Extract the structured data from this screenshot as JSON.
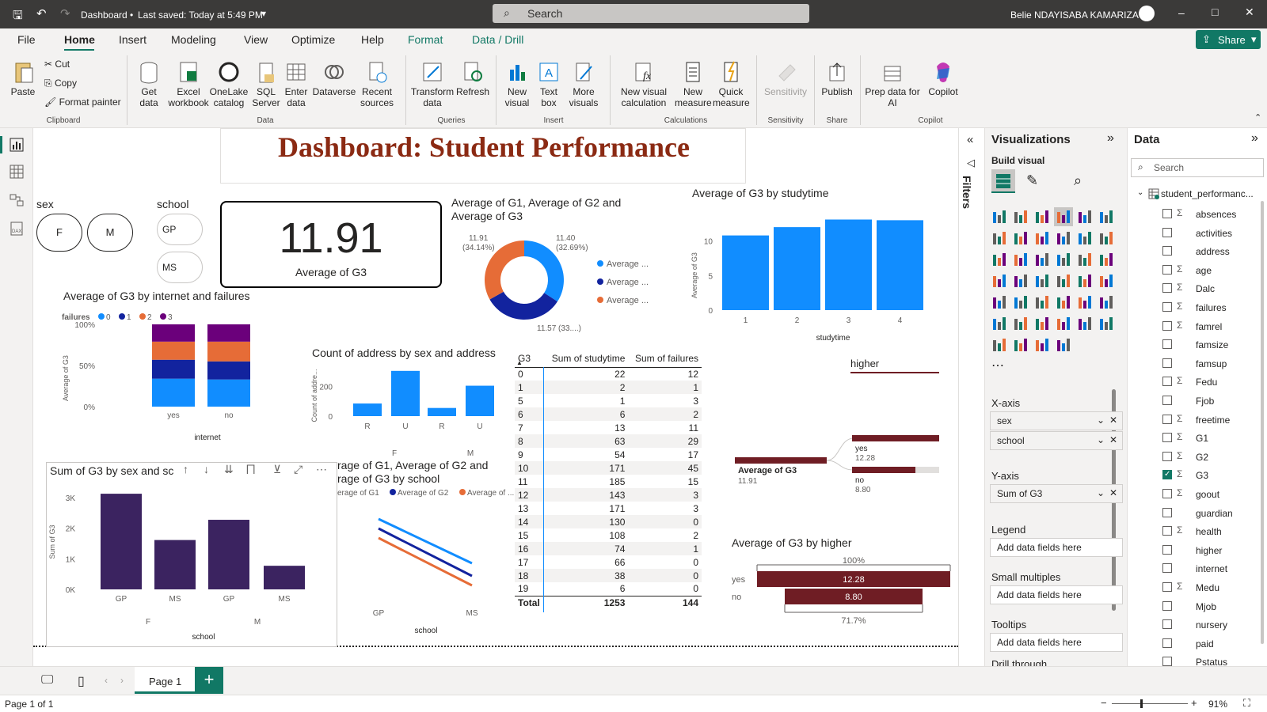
{
  "titlebar": {
    "doc": "Dashboard",
    "saved": "Last saved: Today at 5:49 PM",
    "search": "Search",
    "user": "Belie NDAYISABA KAMARIZA"
  },
  "menu": [
    "File",
    "Home",
    "Insert",
    "Modeling",
    "View",
    "Optimize",
    "Help",
    "Format",
    "Data / Drill"
  ],
  "share": "Share",
  "ribbon": {
    "paste": "Paste",
    "cut": "Cut",
    "copy": "Copy",
    "format_painter": "Format painter",
    "clipboard": "Clipboard",
    "get_data": "Get data",
    "excel": "Excel workbook",
    "onelake": "OneLake catalog",
    "sql": "SQL Server",
    "enter": "Enter data",
    "dataverse": "Dataverse",
    "recent": "Recent sources",
    "data": "Data",
    "transform": "Transform data",
    "refresh": "Refresh",
    "queries": "Queries",
    "new_visual": "New visual",
    "text_box": "Text box",
    "more_visuals": "More visuals",
    "insert": "Insert",
    "new_visual_calc": "New visual calculation",
    "new_measure": "New measure",
    "quick_measure": "Quick measure",
    "calculations": "Calculations",
    "sensitivity": "Sensitivity",
    "sensitivity_grp": "Sensitivity",
    "publish": "Publish",
    "share_grp": "Share",
    "prep": "Prep data for AI",
    "copilot": "Copilot",
    "copilot_grp": "Copilot"
  },
  "dashboard": {
    "title": "Dashboard: Student Performance",
    "sex_slicer": {
      "title": "sex",
      "items": [
        "F",
        "M"
      ]
    },
    "school_slicer": {
      "title": "school",
      "items": [
        "GP",
        "MS"
      ]
    },
    "card": {
      "value": "11.91",
      "label": "Average of G3"
    },
    "donut": {
      "title": "Average of G1, Average of G2 and Average of G3",
      "legend": [
        "Average ...",
        "Average ...",
        "Average ..."
      ],
      "lbl1": "11.91",
      "lbl1b": "(34.14%)",
      "lbl2": "11.40",
      "lbl2b": "(32.69%)",
      "lbl3": "11.57 (33....)"
    },
    "studytime_chart": {
      "title": "Average of G3 by studytime",
      "xlabel": "studytime",
      "ylabel": "Average of G3"
    },
    "internet_chart": {
      "title": "Average of G3 by internet and failures",
      "legend_title": "failures",
      "legend": [
        "0",
        "1",
        "2",
        "3"
      ],
      "ylabel": "Average of G3",
      "xlabel": "internet"
    },
    "address_chart": {
      "title": "Count of address by sex and address",
      "ylabel": "Count of addre...",
      "groups": [
        "F",
        "M"
      ]
    },
    "matrix": {
      "headers": [
        "G3",
        "Sum of studytime",
        "Sum of failures"
      ],
      "rows": [
        [
          "0",
          "22",
          "12"
        ],
        [
          "1",
          "2",
          "1"
        ],
        [
          "5",
          "1",
          "3"
        ],
        [
          "6",
          "6",
          "2"
        ],
        [
          "7",
          "13",
          "11"
        ],
        [
          "8",
          "63",
          "29"
        ],
        [
          "9",
          "54",
          "17"
        ],
        [
          "10",
          "171",
          "45"
        ],
        [
          "11",
          "185",
          "15"
        ],
        [
          "12",
          "143",
          "3"
        ],
        [
          "13",
          "171",
          "3"
        ],
        [
          "14",
          "130",
          "0"
        ],
        [
          "15",
          "108",
          "2"
        ],
        [
          "16",
          "74",
          "1"
        ],
        [
          "17",
          "66",
          "0"
        ],
        [
          "18",
          "38",
          "0"
        ],
        [
          "19",
          "6",
          "0"
        ]
      ],
      "total": [
        "Total",
        "1253",
        "144"
      ]
    },
    "higher_slicer": {
      "title": "higher"
    },
    "decomp": {
      "root_label": "Average of G3",
      "root_value": "11.91",
      "yes_label": "yes",
      "yes_value": "12.28",
      "no_label": "no",
      "no_value": "8.80"
    },
    "funnel": {
      "title": "Average of G3 by higher",
      "top_pct": "100%",
      "bottom_pct": "71.7%"
    },
    "sum_chart": {
      "title": "Sum of G3 by sex and sc",
      "ylabel": "Sum of G3",
      "xlabel": "school",
      "groups": [
        "F",
        "M"
      ]
    },
    "line_chart": {
      "title_a": "rage of G1, Average of G2 and",
      "title_b": "rage of G3 by school",
      "legend": [
        "erage of G1",
        "Average of G2",
        "Average of ..."
      ],
      "xlabel": "school"
    }
  },
  "viz": {
    "title": "Visualizations",
    "build": "Build visual",
    "xaxis": "X-axis",
    "x1": "sex",
    "x2": "school",
    "yaxis": "Y-axis",
    "y1": "Sum of G3",
    "legend": "Legend",
    "small": "Small multiples",
    "tooltips": "Tooltips",
    "drill": "Drill through",
    "add": "Add data fields here"
  },
  "datapane": {
    "title": "Data",
    "search": "Search",
    "table": "student_performanc...",
    "fields": [
      {
        "n": "absences",
        "s": true
      },
      {
        "n": "activities",
        "s": false
      },
      {
        "n": "address",
        "s": false
      },
      {
        "n": "age",
        "s": true
      },
      {
        "n": "Dalc",
        "s": true
      },
      {
        "n": "failures",
        "s": true
      },
      {
        "n": "famrel",
        "s": true
      },
      {
        "n": "famsize",
        "s": false
      },
      {
        "n": "famsup",
        "s": false
      },
      {
        "n": "Fedu",
        "s": true
      },
      {
        "n": "Fjob",
        "s": false
      },
      {
        "n": "freetime",
        "s": true
      },
      {
        "n": "G1",
        "s": true
      },
      {
        "n": "G2",
        "s": true
      },
      {
        "n": "G3",
        "s": true
      },
      {
        "n": "goout",
        "s": true
      },
      {
        "n": "guardian",
        "s": false
      },
      {
        "n": "health",
        "s": true
      },
      {
        "n": "higher",
        "s": false
      },
      {
        "n": "internet",
        "s": false
      },
      {
        "n": "Medu",
        "s": true
      },
      {
        "n": "Mjob",
        "s": false
      },
      {
        "n": "nursery",
        "s": false
      },
      {
        "n": "paid",
        "s": false
      },
      {
        "n": "Pstatus",
        "s": false
      }
    ]
  },
  "pages": {
    "page1": "Page 1",
    "status": "Page 1 of 1",
    "zoom": "91%"
  },
  "chart_data": [
    {
      "type": "bar",
      "title": "Average of G3 by studytime",
      "categories": [
        "1",
        "2",
        "3",
        "4"
      ],
      "values": [
        10.8,
        12.0,
        13.1,
        13.0
      ],
      "ylim": [
        0,
        13.5
      ],
      "yticks": [
        "0",
        "5",
        "10"
      ],
      "xlabel": "studytime",
      "ylabel": "Average of G3"
    },
    {
      "type": "bar",
      "stacked": "100%",
      "title": "Average of G3 by internet and failures",
      "categories": [
        "yes",
        "no"
      ],
      "series": [
        {
          "name": "0",
          "values": [
            0.34,
            0.33
          ]
        },
        {
          "name": "1",
          "values": [
            0.23,
            0.22
          ]
        },
        {
          "name": "2",
          "values": [
            0.22,
            0.24
          ]
        },
        {
          "name": "3",
          "values": [
            0.21,
            0.21
          ]
        }
      ],
      "yticks": [
        "0%",
        "50%",
        "100%"
      ]
    },
    {
      "type": "bar",
      "title": "Count of address by sex and address",
      "categories": [
        "R",
        "U",
        "R",
        "U"
      ],
      "groups": [
        "F",
        "M"
      ],
      "values": [
        85,
        305,
        55,
        205
      ],
      "ylim": [
        0,
        320
      ],
      "yticks": [
        "0",
        "200"
      ]
    },
    {
      "type": "pie",
      "title": "Average of G1, Average of G2 and Average of G3",
      "values": [
        11.91,
        11.4,
        11.57
      ],
      "percent": [
        34.14,
        32.69,
        33.17
      ]
    },
    {
      "type": "bar",
      "title": "Sum of G3 by sex and school",
      "categories": [
        "GP",
        "MS",
        "GP",
        "MS"
      ],
      "groups": [
        "F",
        "M"
      ],
      "values": [
        3120,
        1610,
        2270,
        770
      ],
      "ylim": [
        0,
        3200
      ],
      "yticks": [
        "0K",
        "1K",
        "2K",
        "3K"
      ]
    },
    {
      "type": "line",
      "title": "Average of G1, Average of G2 and Average of G3 by school",
      "x": [
        "GP",
        "MS"
      ],
      "series": [
        {
          "values": [
            12.2,
            10.8
          ]
        },
        {
          "values": [
            11.9,
            10.4
          ]
        },
        {
          "values": [
            11.6,
            10.1
          ]
        }
      ]
    }
  ]
}
